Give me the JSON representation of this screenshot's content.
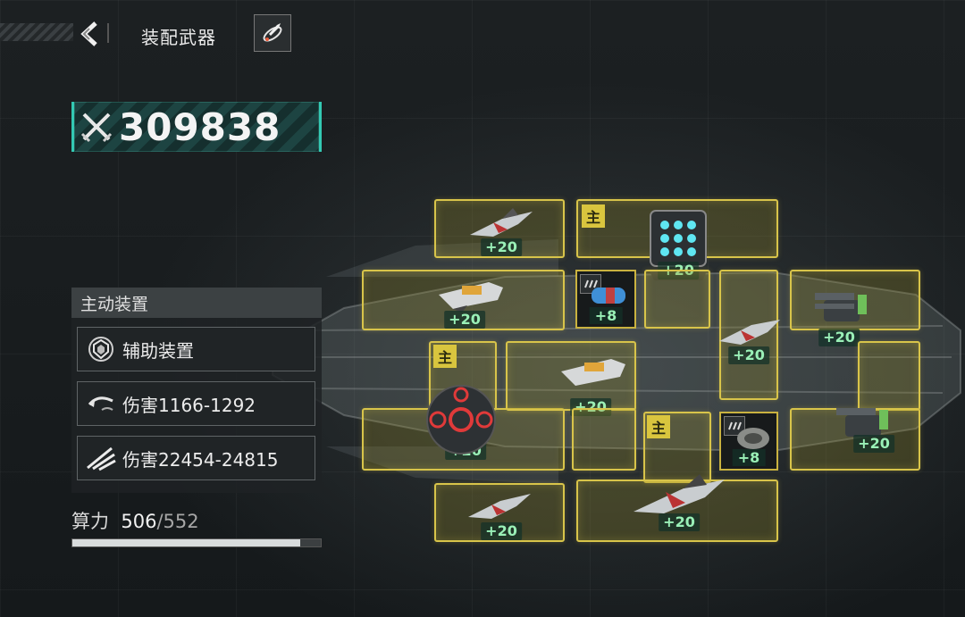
{
  "header": {
    "title": "装配武器"
  },
  "power": {
    "value": "309838"
  },
  "panel": {
    "header": "主动装置",
    "rows": [
      {
        "icon": "shield-emblem-icon",
        "label": "辅助装置"
      },
      {
        "icon": "curved-arrow-icon",
        "label": "伤害1166-1292"
      },
      {
        "icon": "claw-slash-icon",
        "label": "伤害22454-24815"
      }
    ]
  },
  "capacity": {
    "label": "算力",
    "current": "506",
    "max": "552",
    "fraction": 0.917
  },
  "slots": [
    {
      "id": "slot-1",
      "level": "+20",
      "weapon": "fighter-jet-icon",
      "main": ""
    },
    {
      "id": "slot-2",
      "level": "+20",
      "weapon": "missile-pod-icon",
      "main": "主"
    },
    {
      "id": "slot-3",
      "level": "+20",
      "weapon": "railgun-icon",
      "main": ""
    },
    {
      "id": "slot-4",
      "level": "+8",
      "weapon": "battery-icon",
      "main": ""
    },
    {
      "id": "slot-5",
      "level": "+20",
      "weapon": "fighter-jet-icon",
      "main": ""
    },
    {
      "id": "slot-6",
      "level": "+20",
      "weapon": "turret-icon",
      "main": ""
    },
    {
      "id": "slot-7",
      "level": "+20",
      "weapon": "sphere-drone-icon",
      "main": "主"
    },
    {
      "id": "slot-8",
      "level": "+20",
      "weapon": "railgun-icon",
      "main": ""
    },
    {
      "id": "slot-9",
      "level": "+8",
      "weapon": "engine-icon",
      "main": ""
    },
    {
      "id": "slot-10",
      "level": "+20",
      "weapon": "turret-icon",
      "main": ""
    },
    {
      "id": "slot-11",
      "level": "+20",
      "weapon": "fighter-jet-icon",
      "main": ""
    },
    {
      "id": "slot-12",
      "level": "+20",
      "weapon": "fighter-jet-icon",
      "main": "主"
    }
  ],
  "colors": {
    "accent_teal": "#33c9b3",
    "slot_yellow": "#d8c44a",
    "level_green": "#9af0b7"
  }
}
